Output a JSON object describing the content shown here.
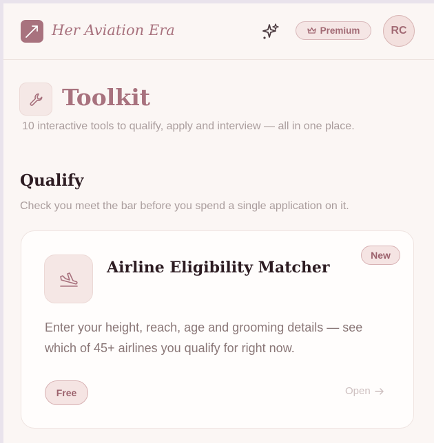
{
  "header": {
    "brand": "Her Aviation Era",
    "premium_label": "Premium",
    "avatar_initials": "RC"
  },
  "page": {
    "title": "Toolkit",
    "subtitle": "10 interactive tools to qualify, apply and interview — all in one place."
  },
  "section": {
    "title": "Qualify",
    "description": "Check you meet the bar before you spend a single application on it."
  },
  "card": {
    "badge": "New",
    "title": "Airline Eligibility Matcher",
    "description": "Enter your height, reach, age and grooming details — see which of 45+ airlines you qualify for right now.",
    "price_tag": "Free",
    "open_label": "Open"
  },
  "icons": {
    "logo": "plane-takeoff-arrow-icon",
    "ai": "sparkle-icon",
    "premium": "crown-icon",
    "title": "wrench-icon",
    "tool": "airplane-landing-icon",
    "open": "arrow-right-icon"
  },
  "colors": {
    "accent": "#a8727e",
    "accent_light": "#f5e4e3",
    "text_dark": "#2d1c22",
    "text_muted": "#aa9d9d",
    "background": "#fbf6f4"
  }
}
